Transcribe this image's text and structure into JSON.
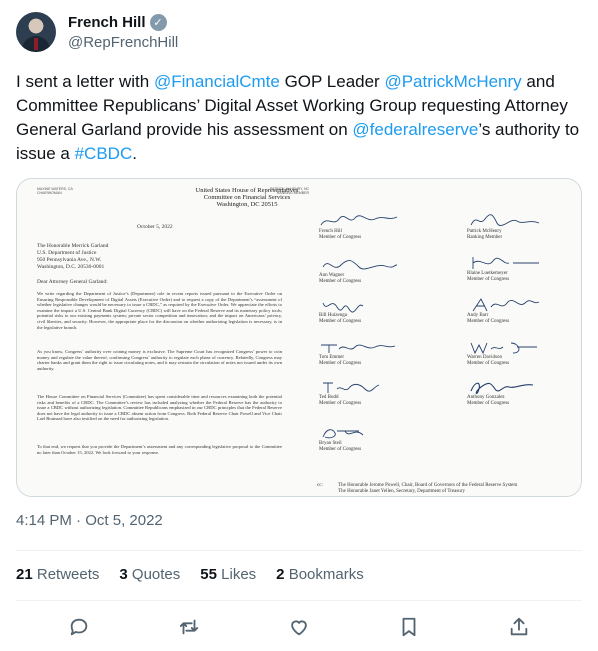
{
  "author": {
    "display_name": "French Hill",
    "handle": "@RepFrenchHill",
    "verified_icon": "✓"
  },
  "tweet": {
    "text_parts": [
      {
        "text": "I sent a letter with ",
        "link": false
      },
      {
        "text": "@FinancialCmte",
        "link": true
      },
      {
        "text": " GOP Leader ",
        "link": false
      },
      {
        "text": "@PatrickMcHenry",
        "link": true
      },
      {
        "text": " and Committee Republicans’ Digital Asset Working Group requesting Attorney General Garland provide his assessment on ",
        "link": false
      },
      {
        "text": "@federalreserve",
        "link": true
      },
      {
        "text": "’s authority to issue a ",
        "link": false
      },
      {
        "text": "#CBDC",
        "link": true
      },
      {
        "text": ".",
        "link": false
      }
    ]
  },
  "letter": {
    "left_header": "MAXINE WATERS, CA\nCHAIRWOMAN",
    "right_header": "PATRICK McHENRY, NC\nRANKING MEMBER",
    "letterhead": "United States House of Representatives\nCommittee on Financial Services\nWashington, DC 20515",
    "date": "October 5, 2022",
    "address": "The Honorable Merrick Garland\nU.S. Department of Justice\n950 Pennsylvania Ave., N.W.\nWashington, D.C. 20530-0001",
    "salutation": "Dear Attorney General Garland:",
    "p1": "We write regarding the Department of Justice’s (Department) role in recent reports issued pursuant to the Executive Order on Ensuring Responsible Development of Digital Assets (Executive Order) and to request a copy of the Department’s “assessment of whether legislative changes would be necessary to issue a CBDC,” as required by the Executive Order. We appreciate the efforts to examine the impact a U.S. Central Bank Digital Currency (CBDC) will have on the Federal Reserve and its monetary policy tools; potential risks to our existing payments system; private sector competition and innovation; and the impact on Americans’ privacy, civil liberties, and security. However, the appropriate place for the discussion on whether authorizing legislation is necessary, is in the legislative branch.",
    "p2": "As you know, Congress’ authority over coining money is exclusive. The Supreme Court has recognized Congress’ power to coin money and regulate the value thereof, confirming Congress’ authority to regulate each phase of currency. Relatedly, Congress may charter banks and grant them the right to issue circulating notes, and it may restrain the circulation of notes not issued under its own authority.",
    "p3": "The House Committee on Financial Services (Committee) has spent considerable time and resources examining both the potential risks and benefits of a CBDC. The Committee’s review has included analyzing whether the Federal Reserve has the authority to issue a CBDC without authorizing legislation. Committee Republicans emphasized in our CBDC principles that the Federal Reserve does not have the legal authority to issue a CBDC absent action from Congress. Both Federal Reserve Chair Powell and Vice Chair Lael Brainard have also testified on the need for authorizing legislation.",
    "p4": "To that end, we request that you provide the Department’s assessment and any corresponding legislative proposal to the Committee no later than October 15, 2022. We look forward to your response.",
    "signatories_left": [
      {
        "name": "French Hill",
        "title": "Member of Congress"
      },
      {
        "name": "Ann Wagner",
        "title": "Member of Congress"
      },
      {
        "name": "Bill Huizenga",
        "title": "Member of Congress"
      },
      {
        "name": "Tom Emmer",
        "title": "Member of Congress"
      },
      {
        "name": "Ted Budd",
        "title": "Member of Congress"
      },
      {
        "name": "Bryan Steil",
        "title": "Member of Congress"
      }
    ],
    "signatories_right": [
      {
        "name": "Patrick McHenry",
        "title": "Ranking Member"
      },
      {
        "name": "Blaine Luetkemeyer",
        "title": "Member of Congress"
      },
      {
        "name": "Andy Barr",
        "title": "Member of Congress"
      },
      {
        "name": "Warren Davidson",
        "title": "Member of Congress"
      },
      {
        "name": "Anthony Gonzalez",
        "title": "Member of Congress"
      }
    ],
    "cc_label": "cc:",
    "cc_text": "The Honorable Jerome Powell, Chair, Board of Governors of the Federal Reserve System\nThe Honorable Janet Yellen, Secretary, Department of Treasury"
  },
  "meta": {
    "time": "4:14 PM",
    "separator": "·",
    "date": "Oct 5, 2022"
  },
  "stats": {
    "retweets_count": "21",
    "retweets_label": "Retweets",
    "quotes_count": "3",
    "quotes_label": "Quotes",
    "likes_count": "55",
    "likes_label": "Likes",
    "bookmarks_count": "2",
    "bookmarks_label": "Bookmarks"
  }
}
